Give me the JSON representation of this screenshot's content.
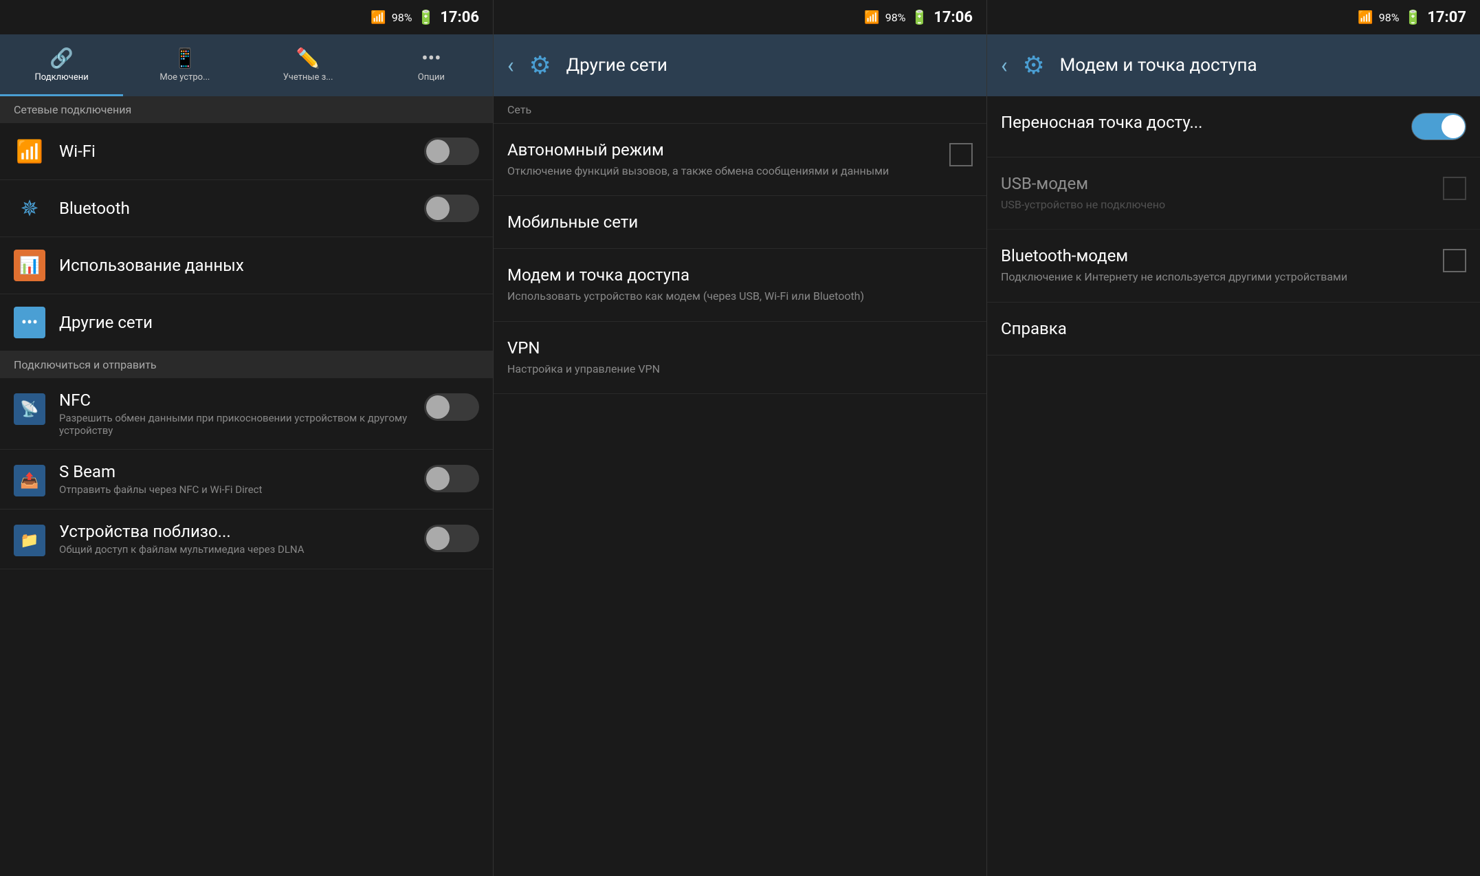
{
  "panel1": {
    "statusBar": {
      "battery": "98%",
      "time": "17:06"
    },
    "tabs": [
      {
        "id": "connections",
        "label": "Подключени",
        "icon": "📶",
        "active": true
      },
      {
        "id": "mydevice",
        "label": "Мое устро...",
        "icon": "📱",
        "active": false
      },
      {
        "id": "accounts",
        "label": "Учетные з...",
        "icon": "✏️",
        "active": false
      },
      {
        "id": "options",
        "label": "Опции",
        "icon": "•••",
        "active": false
      }
    ],
    "sectionNetwork": "Сетевые подключения",
    "items": [
      {
        "id": "wifi",
        "title": "Wi-Fi",
        "toggle": true,
        "toggleState": "off"
      },
      {
        "id": "bluetooth",
        "title": "Bluetooth",
        "toggle": true,
        "toggleState": "off"
      }
    ],
    "itemDataUsage": {
      "title": "Использование данных"
    },
    "itemOtherNets": {
      "title": "Другие сети"
    },
    "sectionConnect": "Подключиться и отправить",
    "nfc": {
      "title": "NFC",
      "subtitle": "Разрешить обмен данными при прикосновении устройством к другому устройству",
      "toggleState": "off"
    },
    "sbeam": {
      "title": "S Beam",
      "subtitle": "Отправить файлы через NFC и Wi-Fi Direct",
      "toggleState": "off"
    },
    "nearby": {
      "title": "Устройства поблизо...",
      "subtitle": "Общий доступ к файлам мультимедиа через DLNA",
      "toggleState": "off"
    }
  },
  "panel2": {
    "statusBar": {
      "battery": "98%",
      "time": "17:06"
    },
    "header": {
      "title": "Другие сети",
      "backLabel": "‹"
    },
    "sectionNet": "Сеть",
    "items": [
      {
        "id": "autonomous",
        "title": "Автономный режим",
        "subtitle": "Отключение функций вызовов, а также обмена сообщениями и данными",
        "hasCheckbox": true
      },
      {
        "id": "mobile",
        "title": "Мобильные сети",
        "subtitle": "",
        "hasCheckbox": false
      },
      {
        "id": "modem",
        "title": "Модем и точка доступа",
        "subtitle": "Использовать устройство как модем (через USB, Wi-Fi или Bluetooth)",
        "hasCheckbox": false
      },
      {
        "id": "vpn",
        "title": "VPN",
        "subtitle": "Настройка и управление VPN",
        "hasCheckbox": false
      }
    ]
  },
  "panel3": {
    "statusBar": {
      "battery": "98%",
      "time": "17:07"
    },
    "header": {
      "title": "Модем и точка доступа",
      "backLabel": "‹"
    },
    "items": [
      {
        "id": "hotspot",
        "title": "Переносная точка досту...",
        "subtitle": "",
        "hasToggle": true,
        "toggleState": "on"
      },
      {
        "id": "usbmodem",
        "title": "USB-модем",
        "subtitle": "USB-устройство не подключено",
        "hasCheckbox": true,
        "disabled": true
      },
      {
        "id": "btmodem",
        "title": "Bluetooth-модем",
        "subtitle": "Подключение к Интернету не используется другими устройствами",
        "hasCheckbox": true,
        "disabled": false
      },
      {
        "id": "help",
        "title": "Справка",
        "subtitle": "",
        "hasCheckbox": false
      }
    ]
  }
}
